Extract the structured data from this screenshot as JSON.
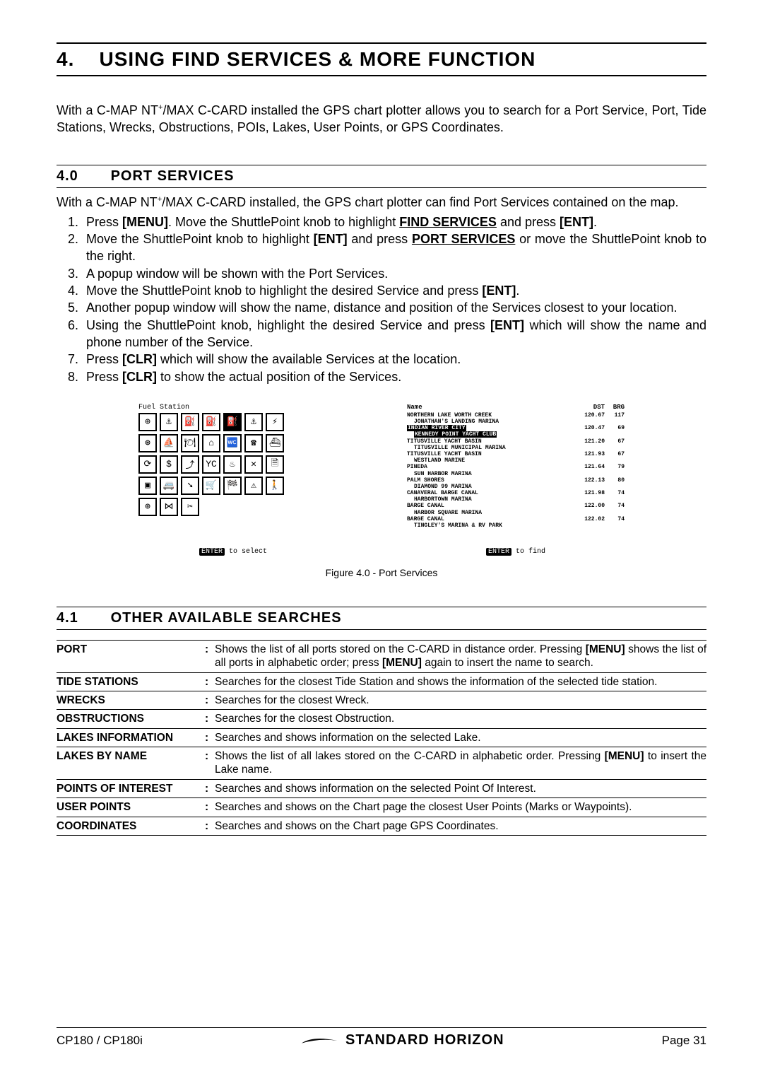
{
  "chapter": {
    "number": "4.",
    "title": "USING FIND SERVICES & MORE FUNCTION"
  },
  "intro": {
    "pre": "With a C-MAP NT",
    "sup": "+",
    "post": "/MAX C-CARD installed the GPS chart plotter allows you to search for a Port Service, Port, Tide Stations, Wrecks, Obstructions, POIs, Lakes, User Points, or GPS Coordinates."
  },
  "s40": {
    "num": "4.0",
    "title": "PORT SERVICES",
    "lead_pre": "With a C-MAP NT",
    "lead_sup": "+",
    "lead_post": "/MAX C-CARD installed, the GPS chart plotter can find Port Services contained on the map.",
    "steps": [
      {
        "pre": "Press ",
        "b1": "[MENU]",
        "mid": ". Move the ShuttlePoint knob to highlight ",
        "u": "FIND SERVICES",
        "post": " and press ",
        "b2": "[ENT]",
        "end": "."
      },
      {
        "pre": "Move the ShuttlePoint knob to highlight ",
        "u": "PORT SERVICES",
        "mid": " and press ",
        "b1": "[ENT]",
        "post": " or move the ShuttlePoint knob to the right.",
        "b2": "",
        "end": ""
      },
      {
        "pre": "A popup window will be shown with the Port Services.",
        "u": "",
        "mid": "",
        "b1": "",
        "post": "",
        "b2": "",
        "end": ""
      },
      {
        "pre": "Move the ShuttlePoint knob to highlight the desired Service and press ",
        "b1": "[ENT]",
        "mid": "",
        "u": "",
        "post": ".",
        "b2": "",
        "end": ""
      },
      {
        "pre": "Another popup window will show the name, distance and position of the Services closest to your location.",
        "u": "",
        "mid": "",
        "b1": "",
        "post": "",
        "b2": "",
        "end": ""
      },
      {
        "pre": "Using the ShuttlePoint knob, highlight the desired Service and press ",
        "b1": "[ENT]",
        "mid": " which will show the name and phone number of the Service.",
        "u": "",
        "post": "",
        "b2": "",
        "end": ""
      },
      {
        "pre": "Press ",
        "b1": "[CLR]",
        "mid": " which will show the available Services at the location.",
        "u": "",
        "post": "",
        "b2": "",
        "end": ""
      },
      {
        "pre": "Press ",
        "b1": "[CLR]",
        "mid": " to show the actual position of the Services.",
        "u": "",
        "post": "",
        "b2": "",
        "end": ""
      }
    ]
  },
  "figure": {
    "left_title": "Fuel Station",
    "left_footer_key": "ENTER",
    "left_footer_text": " to select",
    "icons": [
      "⊕",
      "⚓",
      "⛽",
      "⛽",
      "⛽",
      "⚓",
      "⚡",
      "⊛",
      "⛵",
      "🍽",
      "⌂",
      "🚾",
      "☎",
      "⛴",
      "⟳",
      "$",
      "⤴",
      "YC",
      "♨",
      "✕",
      "🗎",
      "▣",
      "🚐",
      "➘",
      "🛒",
      "🏁",
      "⚠",
      "🚶",
      "⊕",
      "⋈",
      "✂"
    ],
    "selected_icon_index": 4,
    "right_header": {
      "name": "Name",
      "dst": "DST",
      "brg": "BRG"
    },
    "rows": [
      {
        "name": "NORTHERN LAKE WORTH CREEK",
        "sub": "JONATHAN'S LANDING MARINA",
        "dst": "120.67",
        "brg": "117",
        "sel": false
      },
      {
        "name": "INDIAN RIVER CITY",
        "sub": "KENNEDY POINT YACHT CLUB",
        "dst": "120.47",
        "brg": "69",
        "sel": true
      },
      {
        "name": "TITUSVILLE YACHT BASIN",
        "sub": "TITUSVILLE MUNICIPAL MARINA",
        "dst": "121.20",
        "brg": "67",
        "sel": false
      },
      {
        "name": "TITUSVILLE YACHT BASIN",
        "sub": "WESTLAND MARINE",
        "dst": "121.93",
        "brg": "67",
        "sel": false
      },
      {
        "name": "PINEDA",
        "sub": "SUN HARBOR MARINA",
        "dst": "121.64",
        "brg": "79",
        "sel": false
      },
      {
        "name": "PALM SHORES",
        "sub": "DIAMOND 99 MARINA",
        "dst": "122.13",
        "brg": "80",
        "sel": false
      },
      {
        "name": "CANAVERAL BARGE CANAL",
        "sub": "HARBORTOWN MARINA",
        "dst": "121.98",
        "brg": "74",
        "sel": false
      },
      {
        "name": "BARGE CANAL",
        "sub": "HARBOR SQUARE MARINA",
        "dst": "122.00",
        "brg": "74",
        "sel": false
      },
      {
        "name": "BARGE CANAL",
        "sub": "TINGLEY'S MARINA & RV PARK",
        "dst": "122.02",
        "brg": "74",
        "sel": false
      }
    ],
    "right_footer_key": "ENTER",
    "right_footer_text": " to find",
    "caption": "Figure 4.0 - Port Services"
  },
  "s41": {
    "num": "4.1",
    "title": "OTHER AVAILABLE SEARCHES"
  },
  "searches": [
    {
      "label": "PORT",
      "desc_pre": "Shows the list of all ports stored on the C-CARD in distance order. Pressing ",
      "b1": "[MENU]",
      "desc_mid": " shows the list of all ports in alphabetic order; press ",
      "b2": "[MENU]",
      "desc_post": " again to insert the name to search."
    },
    {
      "label": "TIDE STATIONS",
      "desc_pre": "Searches for the closest Tide Station and shows the information of the selected tide station.",
      "b1": "",
      "desc_mid": "",
      "b2": "",
      "desc_post": ""
    },
    {
      "label": "WRECKS",
      "desc_pre": "Searches for the closest Wreck.",
      "b1": "",
      "desc_mid": "",
      "b2": "",
      "desc_post": ""
    },
    {
      "label": "OBSTRUCTIONS",
      "desc_pre": "Searches for the closest Obstruction.",
      "b1": "",
      "desc_mid": "",
      "b2": "",
      "desc_post": ""
    },
    {
      "label": "LAKES INFORMATION",
      "desc_pre": "Searches and shows information on the selected Lake.",
      "b1": "",
      "desc_mid": "",
      "b2": "",
      "desc_post": ""
    },
    {
      "label": "LAKES BY NAME",
      "desc_pre": "Shows the list of all lakes stored on the C-CARD in alphabetic order. Pressing ",
      "b1": "[MENU]",
      "desc_mid": " to insert the Lake name.",
      "b2": "",
      "desc_post": ""
    },
    {
      "label": "POINTS OF INTEREST",
      "desc_pre": "Searches and shows information on the selected Point Of Interest.",
      "b1": "",
      "desc_mid": "",
      "b2": "",
      "desc_post": ""
    },
    {
      "label": "USER POINTS",
      "desc_pre": "Searches and shows on the Chart page the closest User Points (Marks or Waypoints).",
      "b1": "",
      "desc_mid": "",
      "b2": "",
      "desc_post": ""
    },
    {
      "label": "COORDINATES",
      "desc_pre": "Searches and shows on the Chart page GPS Coordinates.",
      "b1": "",
      "desc_mid": "",
      "b2": "",
      "desc_post": ""
    }
  ],
  "footer": {
    "left": "CP180 / CP180i",
    "brand": "STANDARD HORIZON",
    "right": "Page 31"
  }
}
